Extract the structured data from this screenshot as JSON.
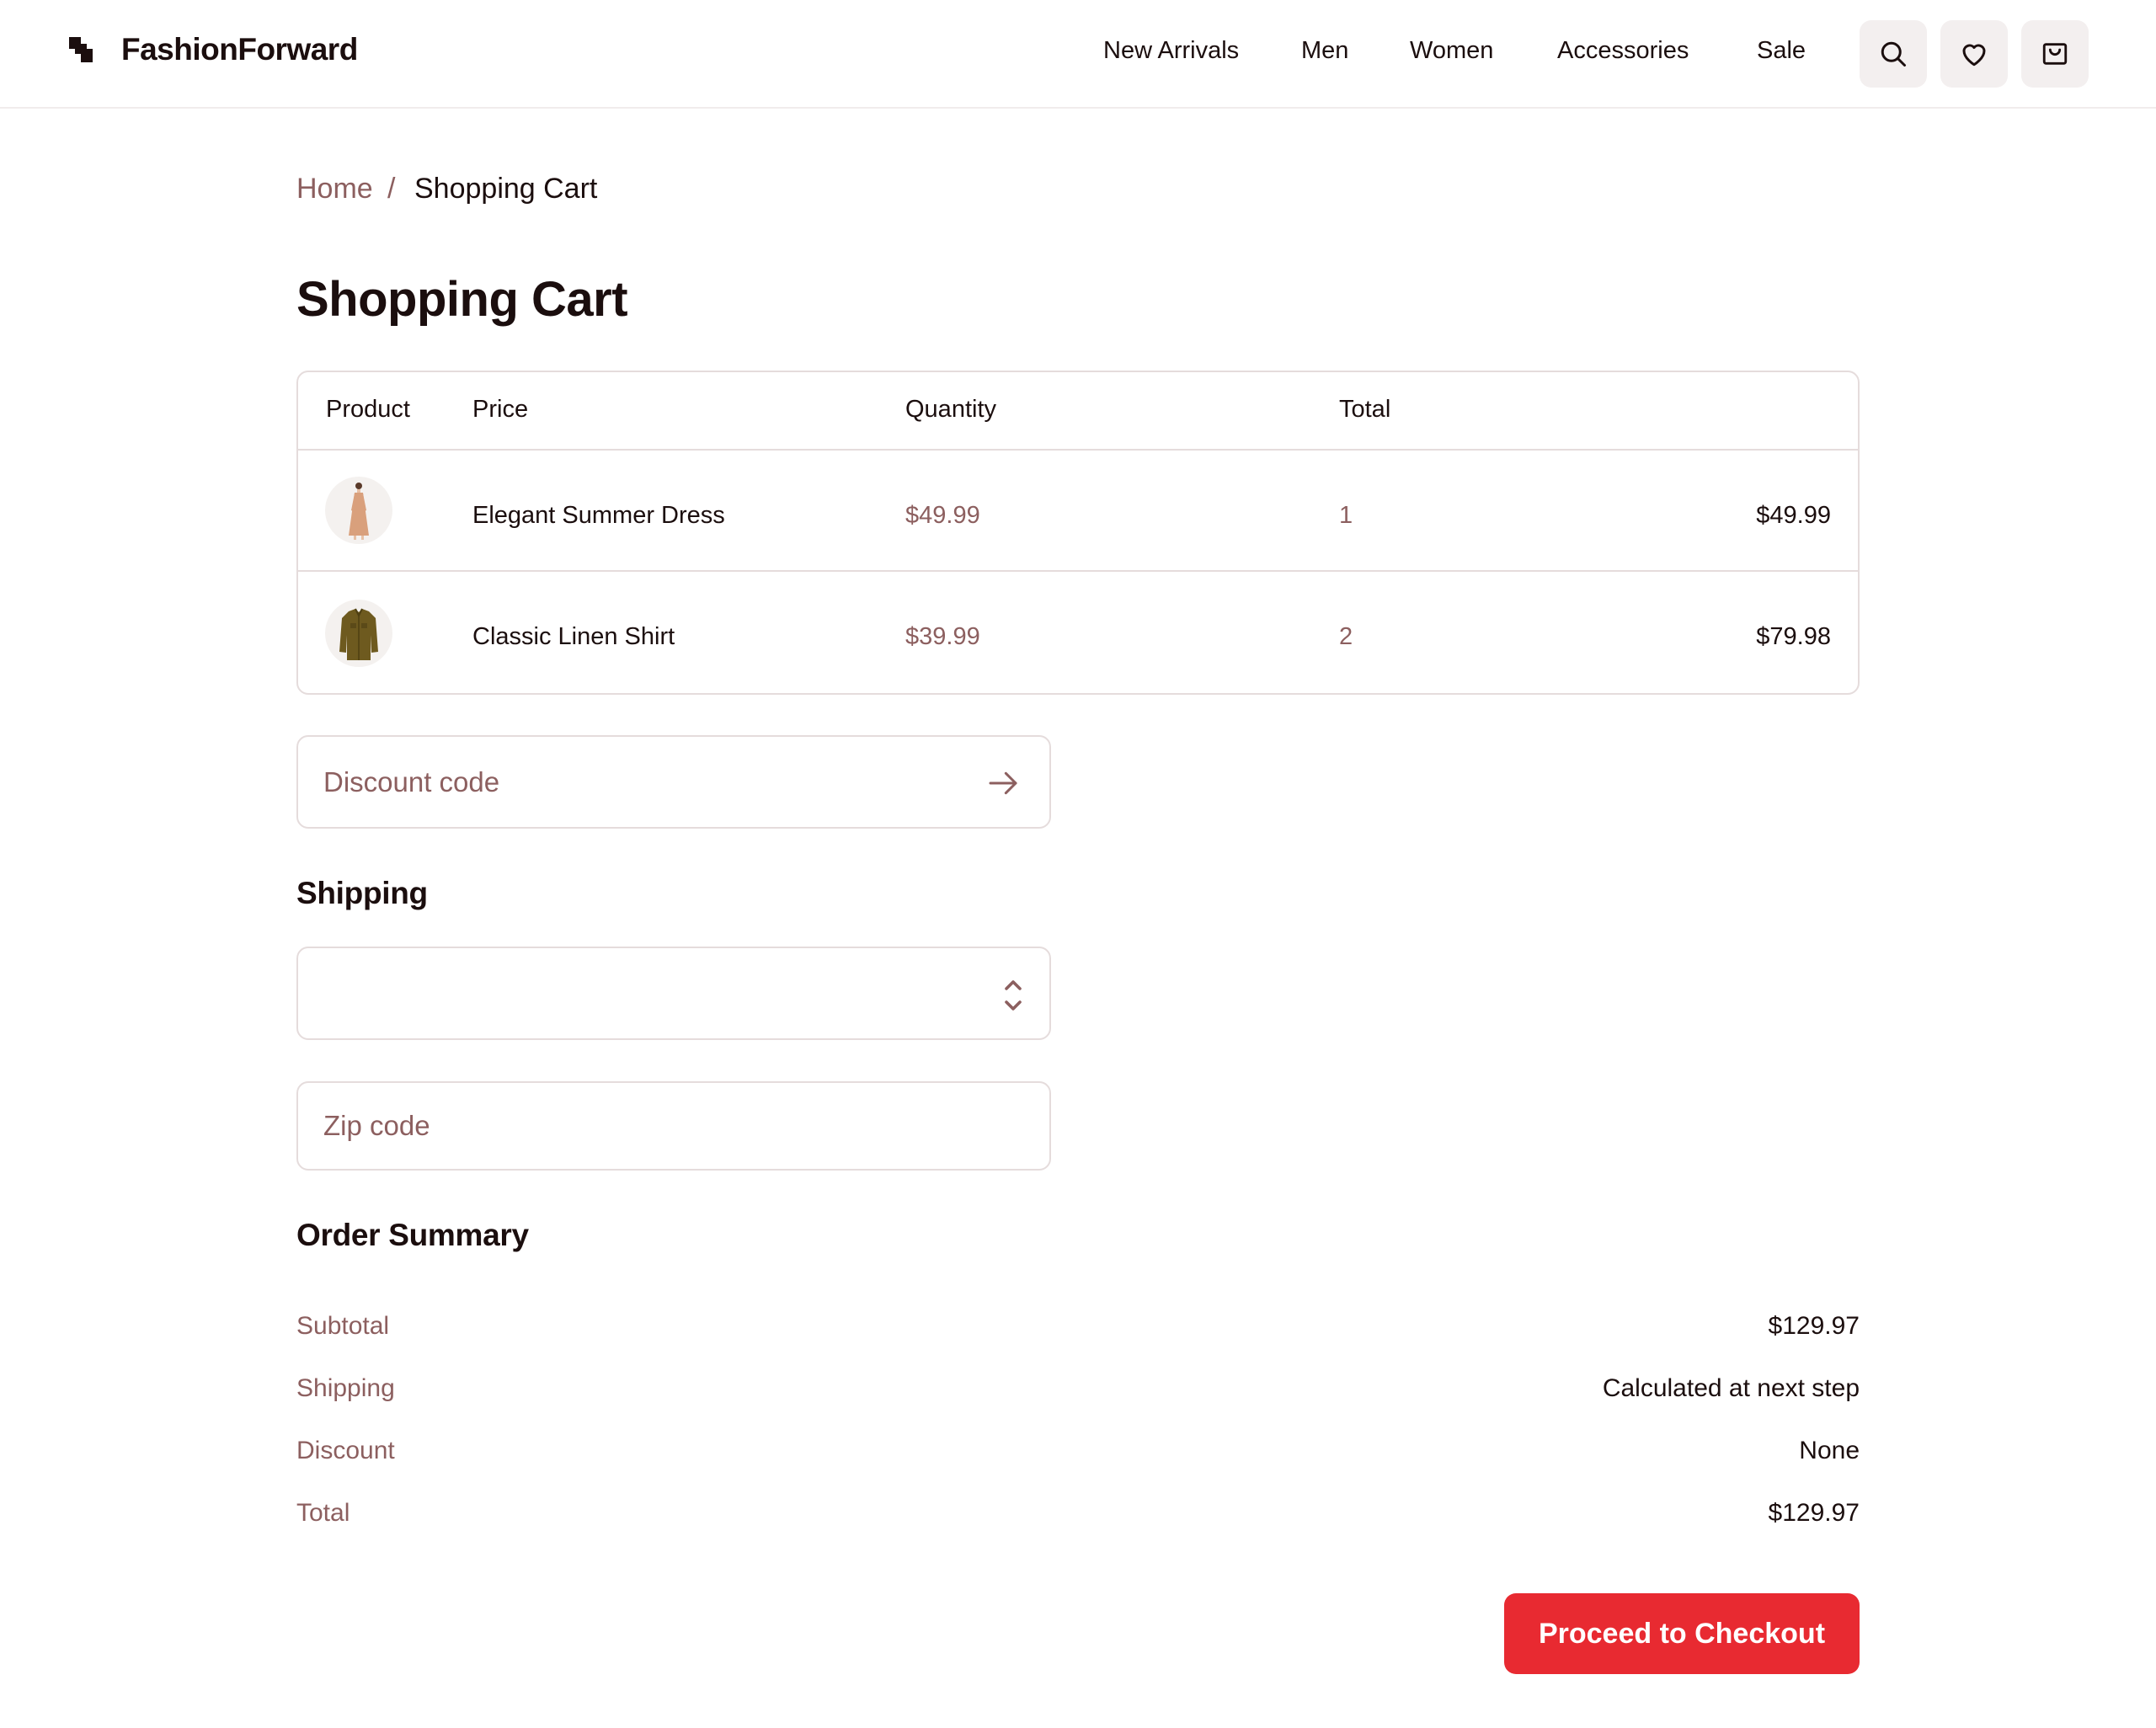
{
  "brand": {
    "name": "FashionForward"
  },
  "nav": {
    "items": [
      "New Arrivals",
      "Men",
      "Women",
      "Accessories",
      "Sale"
    ]
  },
  "header_icons": [
    "search-icon",
    "heart-icon",
    "shopping-bag-icon"
  ],
  "breadcrumb": {
    "home": "Home",
    "separator": "/",
    "current": "Shopping Cart"
  },
  "page": {
    "title": "Shopping Cart"
  },
  "cart": {
    "columns": {
      "product": "Product",
      "price": "Price",
      "quantity": "Quantity",
      "total": "Total"
    },
    "items": [
      {
        "name": "Elegant Summer Dress",
        "price": "$49.99",
        "quantity": "1",
        "total": "$49.99"
      },
      {
        "name": "Classic Linen Shirt",
        "price": "$39.99",
        "quantity": "2",
        "total": "$79.98"
      }
    ]
  },
  "discount": {
    "placeholder": "Discount code",
    "value": ""
  },
  "shipping": {
    "title": "Shipping",
    "selected": "",
    "zip_placeholder": "Zip code",
    "zip_value": ""
  },
  "summary": {
    "title": "Order Summary",
    "rows": [
      {
        "label": "Subtotal",
        "value": "$129.97"
      },
      {
        "label": "Shipping",
        "value": "Calculated at next step"
      },
      {
        "label": "Discount",
        "value": "None"
      },
      {
        "label": "Total",
        "value": "$129.97"
      }
    ]
  },
  "checkout": {
    "label": "Proceed to Checkout"
  },
  "colors": {
    "accent": "#e82a31",
    "muted_text": "#8c5f5f",
    "text": "#1b0e0e",
    "border": "#e5dcdc",
    "icon_bg": "#f3efef"
  }
}
